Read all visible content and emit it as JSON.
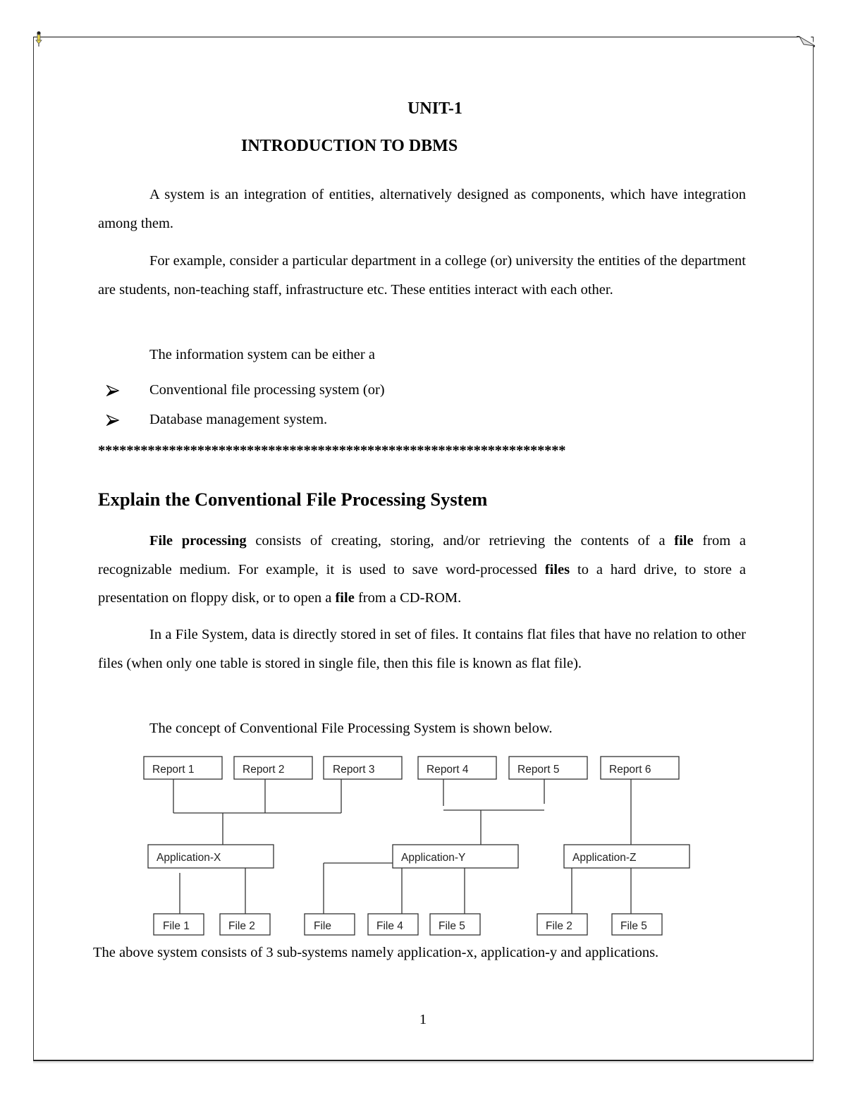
{
  "page": {
    "unit_title": "UNIT-1",
    "chapter_title": "INTRODUCTION TO DBMS",
    "page_number": "1"
  },
  "intro": {
    "para1": "A system is an integration of entities, alternatively designed as components, which have integration among them.",
    "para2": "For example, consider a particular department in a college (or) university the entities of the department are students, non-teaching staff, infrastructure etc. These entities interact with each other.",
    "para3": "The information system can be either a",
    "bullets": [
      "Conventional file processing system (or)",
      "Database management system."
    ]
  },
  "separator": "******************************************************************",
  "section": {
    "heading": "Explain the Conventional File Processing System",
    "para1": {
      "parts": [
        {
          "text": "File processing",
          "bold": true
        },
        {
          "text": " consists of creating, storing, and/or retrieving the contents of a ",
          "bold": false
        },
        {
          "text": "file",
          "bold": true
        },
        {
          "text": " from a recognizable medium. For example, it is used to save word-processed ",
          "bold": false
        },
        {
          "text": "files",
          "bold": true
        },
        {
          "text": " to a hard drive, to store a presentation on floppy disk, or to open a ",
          "bold": false
        },
        {
          "text": "file",
          "bold": true
        },
        {
          "text": " from a CD-ROM.",
          "bold": false
        }
      ]
    },
    "para2": "In a File System, data is directly stored in set of files. It contains flat files that have no relation to other files (when only one table is stored in single file, then this file is known as flat file).",
    "para3": "The concept of Conventional File Processing System is shown below.",
    "para4": "The above system consists of 3 sub-systems namely application-x, application-y and applications."
  },
  "diagram": {
    "reports": [
      "Report 1",
      "Report 2",
      "Report 3",
      "Report 4",
      "Report 5",
      "Report 6"
    ],
    "applications": [
      "Application-X",
      "Application-Y",
      "Application-Z"
    ],
    "files": [
      "File 1",
      "File 2",
      "File",
      "File 4",
      "File 5",
      "File 2",
      "File 5"
    ]
  },
  "icons": {
    "top_left": "pushpin-icon",
    "top_right": "page-fold-icon",
    "bullet": "arrow-bullet-icon"
  }
}
